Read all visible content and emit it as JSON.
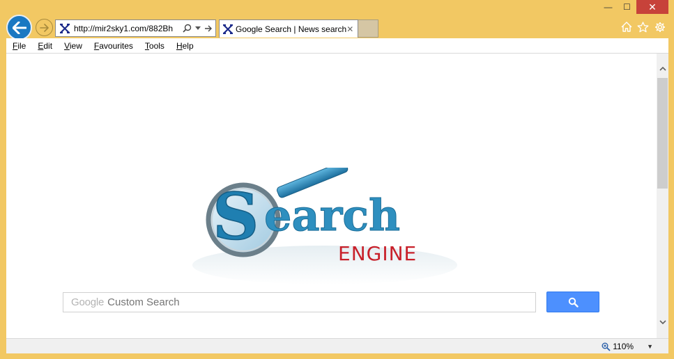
{
  "window": {
    "minimize": "—",
    "maximize": "☐",
    "close": "✕"
  },
  "address_bar": {
    "url": "http://mir2sky1.com/882Bh",
    "favicon": "X"
  },
  "tab": {
    "title": "Google Search | News search",
    "favicon": "X",
    "close": "✕"
  },
  "menu": [
    {
      "label": "File",
      "access": "F",
      "rest": "ile"
    },
    {
      "label": "Edit",
      "access": "E",
      "rest": "dit"
    },
    {
      "label": "View",
      "access": "V",
      "rest": "iew"
    },
    {
      "label": "Favourites",
      "access": "F",
      "rest": "avourites"
    },
    {
      "label": "Tools",
      "access": "T",
      "rest": "ools"
    },
    {
      "label": "Help",
      "access": "H",
      "rest": "elp"
    }
  ],
  "logo": {
    "word1": "Search",
    "word2": "ENGINE"
  },
  "search": {
    "brand": "Google",
    "placeholder": "Custom Search"
  },
  "status": {
    "zoom": "110%"
  },
  "colors": {
    "frame": "#f2c863",
    "back_button": "#1a78c2",
    "search_button": "#4d90fe",
    "logo_blue": "#2e8fbf",
    "logo_red": "#c8202a"
  }
}
